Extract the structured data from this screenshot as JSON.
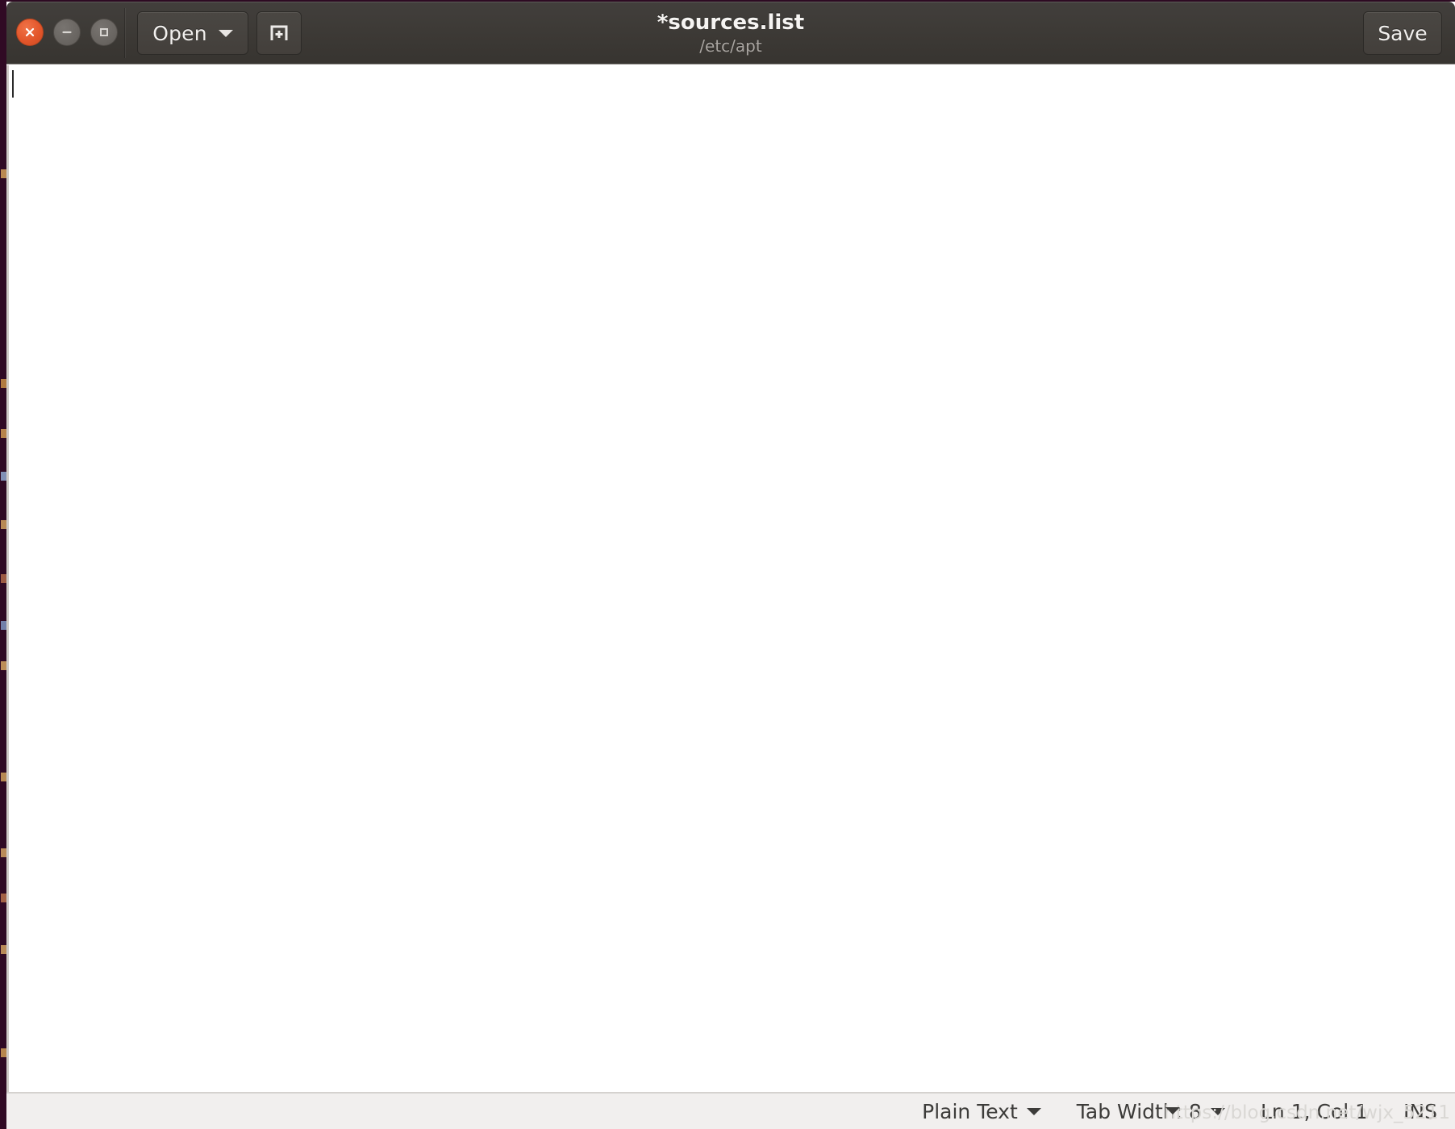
{
  "window": {
    "title": "*sources.list",
    "subtitle": "/etc/apt",
    "controls": {
      "close_name": "close-window-button",
      "minimize_name": "minimize-window-button",
      "maximize_name": "maximize-window-button"
    },
    "accent_color": "#e2552a",
    "headerbar_color": "#3c3935"
  },
  "toolbar": {
    "open_label": "Open",
    "open_caret_icon": "chevron-down-icon",
    "new_document_icon": "new-document-icon",
    "save_label": "Save"
  },
  "editor": {
    "content": "",
    "background_color": "#ffffff",
    "caret_visible": true
  },
  "statusbar": {
    "language_label": "Plain Text",
    "language_caret_icon": "chevron-down-icon",
    "tab_width_label": "Tab Width: 8",
    "tab_width_caret_icon": "chevron-down-icon",
    "position_label": "Ln 1, Col 1",
    "position_caret_icon": "chevron-down-icon",
    "insert_mode_label": "INS",
    "watermark": "https://blog.csdn.net/wjx_5211",
    "background_color": "#f1efee"
  },
  "desktop": {
    "background_color": "#300a24"
  }
}
